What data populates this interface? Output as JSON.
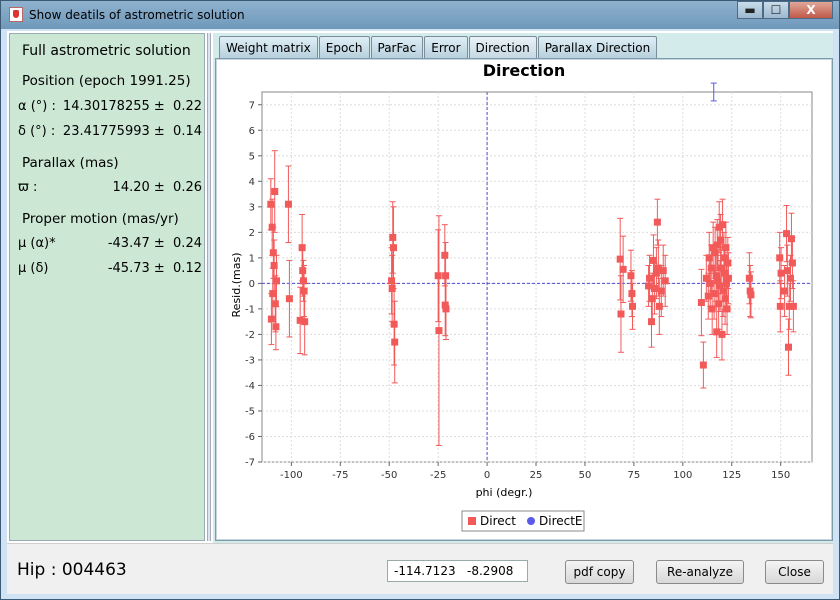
{
  "window": {
    "title": "Show deatils of astrometric solution",
    "buttons": {
      "minimize": "▬",
      "maximize": "☐",
      "close": "X"
    }
  },
  "left_panel": {
    "title": "Full astrometric solution",
    "position_header": "Position (epoch 1991.25)",
    "alpha_label": "α (°) :",
    "alpha_value": "14.30178255 ±  0.22",
    "delta_label": "δ (°) :",
    "delta_value": "23.41775993 ±  0.14",
    "parallax_header": "Parallax (mas)",
    "parallax_label": "ϖ :",
    "parallax_value": "14.20 ±  0.26",
    "pm_header": "Proper motion (mas/yr)",
    "pma_label": "μ (α)*",
    "pma_value": "-43.47 ±  0.24",
    "pmd_label": "μ (δ)",
    "pmd_value": "-45.73 ±  0.12"
  },
  "tabs": [
    "Weight matrix",
    "Epoch",
    "ParFac",
    "Error",
    "Direction",
    "Parallax Direction"
  ],
  "active_tab": "Direction",
  "chart_data": {
    "type": "scatter",
    "title": "Direction",
    "xlabel": "phi (degr.)",
    "ylabel": "Resid.(mas)",
    "xlim": [
      -115,
      166
    ],
    "ylim": [
      -7,
      7.5
    ],
    "xticks": [
      -100,
      -75,
      -50,
      -25,
      0,
      25,
      50,
      75,
      100,
      125,
      150
    ],
    "yticks": [
      -7,
      -6,
      -5,
      -4,
      -3,
      -2,
      -1,
      0,
      1,
      2,
      3,
      4,
      5,
      6,
      7
    ],
    "grid": true,
    "legend_position": "bottom",
    "series": [
      {
        "name": "Direct",
        "color": "#f25a5a",
        "marker": "square",
        "points": [
          [
            -110.5,
            3.1,
            1.0
          ],
          [
            -110.2,
            -1.4,
            1.0
          ],
          [
            -109.8,
            2.2,
            1.1
          ],
          [
            -109.5,
            -0.4,
            1.0
          ],
          [
            -109.2,
            1.2,
            1.0
          ],
          [
            -108.8,
            0.7,
            1.0
          ],
          [
            -108.5,
            3.6,
            1.6
          ],
          [
            -108.2,
            -0.8,
            1.1
          ],
          [
            -107.9,
            -1.7,
            0.9
          ],
          [
            -107.6,
            0.1,
            1.0
          ],
          [
            -101.5,
            3.1,
            1.5
          ],
          [
            -101.0,
            -0.6,
            1.5
          ],
          [
            -95.5,
            -1.45,
            1.3
          ],
          [
            -94.5,
            1.4,
            1.3
          ],
          [
            -94.2,
            0.5,
            1.0
          ],
          [
            -93.8,
            0.1,
            0.8
          ],
          [
            -93.5,
            -0.3,
            1.0
          ],
          [
            -93.2,
            -1.5,
            1.3
          ],
          [
            -48.8,
            0.1,
            1.3
          ],
          [
            -48.5,
            -0.2,
            1.3
          ],
          [
            -48.2,
            1.8,
            1.4
          ],
          [
            -47.8,
            1.4,
            1.6
          ],
          [
            -47.5,
            -1.6,
            1.6
          ],
          [
            -47.2,
            -2.3,
            1.6
          ],
          [
            -25.0,
            0.3,
            1.8
          ],
          [
            -24.6,
            -1.85,
            4.5
          ],
          [
            -21.6,
            1.1,
            1.2
          ],
          [
            -21.4,
            -0.85,
            1.2
          ],
          [
            -21.2,
            0.3,
            1.3
          ],
          [
            -21.0,
            -1.0,
            1.2
          ],
          [
            68.0,
            0.95,
            1.6
          ],
          [
            68.4,
            -1.2,
            1.5
          ],
          [
            69.5,
            0.55,
            1.3
          ],
          [
            73.5,
            0.3,
            1.0
          ],
          [
            74.0,
            -0.4,
            0.9
          ],
          [
            74.3,
            -0.9,
            0.9
          ],
          [
            82.5,
            -0.1,
            0.8
          ],
          [
            83.0,
            0.2,
            0.9
          ],
          [
            84.0,
            -1.5,
            1.0
          ],
          [
            84.4,
            -0.6,
            1.0
          ],
          [
            85.0,
            0.9,
            1.0
          ],
          [
            85.5,
            -0.2,
            1.0
          ],
          [
            86.5,
            0.4,
            1.0
          ],
          [
            87.0,
            2.4,
            0.9
          ],
          [
            87.5,
            0.6,
            1.1
          ],
          [
            88.0,
            -0.9,
            1.1
          ],
          [
            89.0,
            -0.3,
            1.0
          ],
          [
            90.0,
            0.5,
            1.0
          ],
          [
            91.0,
            0.1,
            1.0
          ],
          [
            109.5,
            -0.75,
            1.3
          ],
          [
            110.5,
            -3.2,
            0.9
          ],
          [
            112.0,
            0.2,
            0.9
          ],
          [
            113.0,
            -0.5,
            0.9
          ],
          [
            113.5,
            1.0,
            1.0
          ],
          [
            114.0,
            0.0,
            0.9
          ],
          [
            114.5,
            0.6,
            0.9
          ],
          [
            115.0,
            -1.0,
            1.0
          ],
          [
            115.5,
            1.4,
            1.0
          ],
          [
            116.0,
            -0.4,
            1.0
          ],
          [
            116.5,
            1.2,
            1.0
          ],
          [
            117.0,
            0.3,
            1.0
          ],
          [
            117.3,
            -1.9,
            1.0
          ],
          [
            117.6,
            1.5,
            1.0
          ],
          [
            118.0,
            0.1,
            1.0
          ],
          [
            118.3,
            -0.8,
            1.0
          ],
          [
            118.6,
            2.2,
            1.0
          ],
          [
            119.0,
            -0.1,
            1.0
          ],
          [
            119.3,
            1.7,
            1.0
          ],
          [
            119.6,
            0.6,
            1.0
          ],
          [
            120.0,
            -2.0,
            1.0
          ],
          [
            120.3,
            2.3,
            1.0
          ],
          [
            120.6,
            -0.3,
            1.0
          ],
          [
            121.0,
            1.0,
            1.0
          ],
          [
            121.3,
            0.4,
            1.0
          ],
          [
            121.6,
            -0.6,
            1.0
          ],
          [
            122.0,
            1.4,
            1.0
          ],
          [
            122.3,
            0.0,
            1.0
          ],
          [
            122.6,
            -1.0,
            1.0
          ],
          [
            123.0,
            0.8,
            1.0
          ],
          [
            123.3,
            0.2,
            1.0
          ],
          [
            134.0,
            0.2,
            1.0
          ],
          [
            134.4,
            -0.3,
            1.0
          ],
          [
            134.8,
            -0.45,
            0.9
          ],
          [
            149.5,
            1.0,
            1.0
          ],
          [
            149.8,
            -0.9,
            1.0
          ],
          [
            150.2,
            0.4,
            1.0
          ],
          [
            152.0,
            -0.3,
            1.0
          ],
          [
            153.0,
            1.95,
            1.1
          ],
          [
            153.4,
            0.5,
            1.0
          ],
          [
            154.0,
            -2.5,
            1.1
          ],
          [
            154.4,
            -0.9,
            0.9
          ],
          [
            155.0,
            0.2,
            0.9
          ],
          [
            155.5,
            1.75,
            1.0
          ],
          [
            156.0,
            0.8,
            1.0
          ],
          [
            156.5,
            -0.9,
            1.0
          ]
        ]
      },
      {
        "name": "DirectE",
        "color": "#5a5ae8",
        "marker": "circle",
        "points": [
          [
            115.8,
            7.5,
            0.35
          ]
        ]
      }
    ]
  },
  "bottom": {
    "hip_label": "Hip : 004463",
    "coord_value": "-114.7123   -8.2908",
    "pdf_button": "pdf copy",
    "reanalyze_button": "Re-analyze",
    "close_button": "Close"
  }
}
